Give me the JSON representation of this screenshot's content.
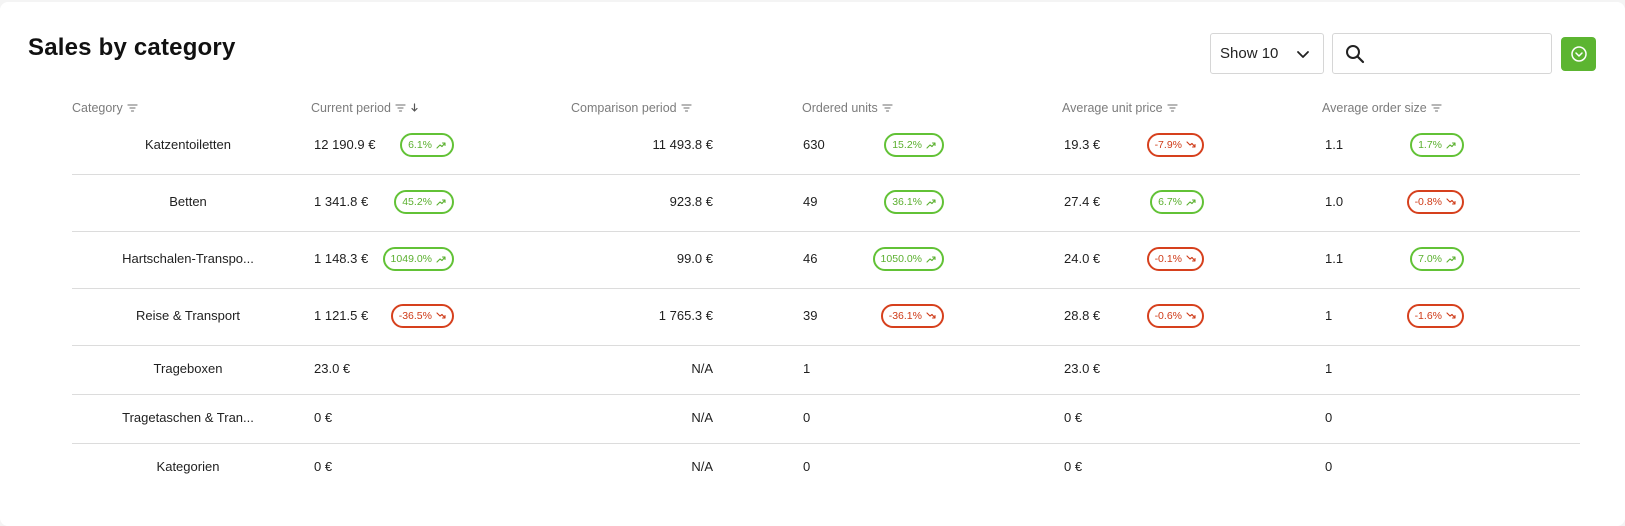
{
  "title": "Sales by category",
  "controls": {
    "show_label": "Show 10",
    "search_placeholder": "",
    "export_color": "#5cb531"
  },
  "columns": [
    "Category",
    "Current period",
    "Comparison period",
    "Ordered units",
    "Average unit price",
    "Average order size"
  ],
  "colors": {
    "up": "#5bb02f",
    "down": "#cf3a17"
  },
  "rows": [
    {
      "category": "Katzentoiletten",
      "current": "12 190.9 €",
      "current_change": {
        "text": "6.1%",
        "dir": "up"
      },
      "comparison": "11 493.8 €",
      "units": "630",
      "units_change": {
        "text": "15.2%",
        "dir": "up"
      },
      "price": "19.3 €",
      "price_change": {
        "text": "-7.9%",
        "dir": "down"
      },
      "size": "1.1",
      "size_change": {
        "text": "1.7%",
        "dir": "up"
      }
    },
    {
      "category": "Betten",
      "current": "1 341.8 €",
      "current_change": {
        "text": "45.2%",
        "dir": "up"
      },
      "comparison": "923.8 €",
      "units": "49",
      "units_change": {
        "text": "36.1%",
        "dir": "up"
      },
      "price": "27.4 €",
      "price_change": {
        "text": "6.7%",
        "dir": "up"
      },
      "size": "1.0",
      "size_change": {
        "text": "-0.8%",
        "dir": "down"
      }
    },
    {
      "category": "Hartschalen-Transpo...",
      "current": "1 148.3 €",
      "current_change": {
        "text": "1049.0%",
        "dir": "up"
      },
      "comparison": "99.0 €",
      "units": "46",
      "units_change": {
        "text": "1050.0%",
        "dir": "up"
      },
      "price": "24.0 €",
      "price_change": {
        "text": "-0.1%",
        "dir": "down"
      },
      "size": "1.1",
      "size_change": {
        "text": "7.0%",
        "dir": "up"
      }
    },
    {
      "category": "Reise & Transport",
      "current": "1 121.5 €",
      "current_change": {
        "text": "-36.5%",
        "dir": "down"
      },
      "comparison": "1 765.3 €",
      "units": "39",
      "units_change": {
        "text": "-36.1%",
        "dir": "down"
      },
      "price": "28.8 €",
      "price_change": {
        "text": "-0.6%",
        "dir": "down"
      },
      "size": "1",
      "size_change": {
        "text": "-1.6%",
        "dir": "down"
      }
    },
    {
      "category": "Trageboxen",
      "current": "23.0 €",
      "current_change": null,
      "comparison": "N/A",
      "units": "1",
      "units_change": null,
      "price": "23.0 €",
      "price_change": null,
      "size": "1",
      "size_change": null
    },
    {
      "category": "Tragetaschen & Tran...",
      "current": "0 €",
      "current_change": null,
      "comparison": "N/A",
      "units": "0",
      "units_change": null,
      "price": "0 €",
      "price_change": null,
      "size": "0",
      "size_change": null
    },
    {
      "category": "Kategorien",
      "current": "0 €",
      "current_change": null,
      "comparison": "N/A",
      "units": "0",
      "units_change": null,
      "price": "0 €",
      "price_change": null,
      "size": "0",
      "size_change": null
    }
  ]
}
